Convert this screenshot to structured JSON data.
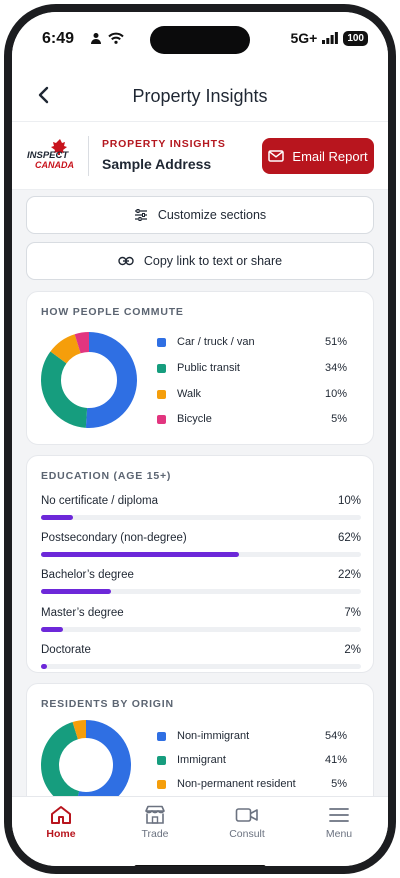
{
  "status_bar": {
    "time": "6:49",
    "network": "5G+",
    "battery": "100"
  },
  "header": {
    "title": "Property Insights"
  },
  "brand": {
    "kicker": "PROPERTY INSIGHTS",
    "address": "Sample Address",
    "logo_top": "INSPECT",
    "logo_bottom": "CANADA",
    "accent_color": "#b8151e"
  },
  "actions": {
    "email_report": "Email Report",
    "customize": "Customize sections",
    "share": "Copy link to text or share"
  },
  "commute": {
    "title": "HOW PEOPLE COMMUTE",
    "items": [
      {
        "label": "Car / truck / van",
        "value": "51%",
        "pct": 51,
        "color": "#2f6fe3"
      },
      {
        "label": "Public transit",
        "value": "34%",
        "pct": 34,
        "color": "#169d7e"
      },
      {
        "label": "Walk",
        "value": "10%",
        "pct": 10,
        "color": "#f59e0b"
      },
      {
        "label": "Bicycle",
        "value": "5%",
        "pct": 5,
        "color": "#e2357f"
      }
    ]
  },
  "education": {
    "title": "EDUCATION (AGE 15+)",
    "bar_color": "#6d28d9",
    "items": [
      {
        "label": "No certificate / diploma",
        "value": "10%",
        "pct": 10
      },
      {
        "label": "Postsecondary (non-degree)",
        "value": "62%",
        "pct": 62
      },
      {
        "label": "Bachelor’s degree",
        "value": "22%",
        "pct": 22
      },
      {
        "label": "Master’s degree",
        "value": "7%",
        "pct": 7
      },
      {
        "label": "Doctorate",
        "value": "2%",
        "pct": 2
      }
    ]
  },
  "origin": {
    "title": "RESIDENTS BY ORIGIN",
    "items": [
      {
        "label": "Non-immigrant",
        "value": "54%",
        "pct": 54,
        "color": "#2f6fe3"
      },
      {
        "label": "Immigrant",
        "value": "41%",
        "pct": 41,
        "color": "#169d7e"
      },
      {
        "label": "Non-permanent resident",
        "value": "5%",
        "pct": 5,
        "color": "#f59e0b"
      }
    ]
  },
  "tabs": [
    {
      "label": "Home",
      "icon": "home-icon",
      "active": true
    },
    {
      "label": "Trade",
      "icon": "store-icon",
      "active": false
    },
    {
      "label": "Consult",
      "icon": "video-icon",
      "active": false
    },
    {
      "label": "Menu",
      "icon": "menu-icon",
      "active": false
    }
  ]
}
